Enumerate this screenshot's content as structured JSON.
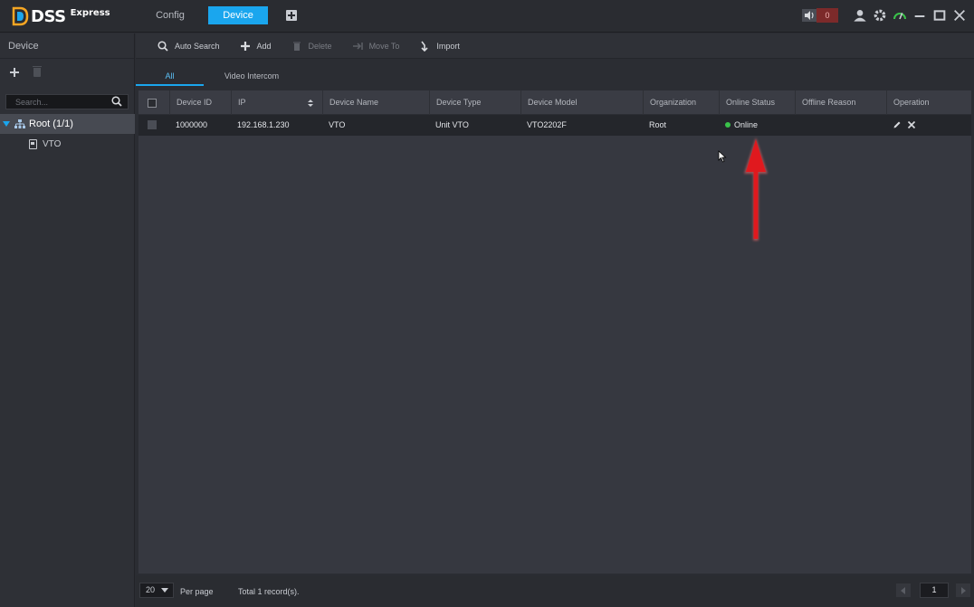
{
  "app": {
    "logo_main": "DSS",
    "logo_sub": "Express",
    "tabs": [
      {
        "label": "Config",
        "active": false
      },
      {
        "label": "Device",
        "active": true
      }
    ],
    "alarm_count": "0",
    "brand_color": "#1aa6ee"
  },
  "sidebar": {
    "title": "Device",
    "search_placeholder": "Search...",
    "tree": {
      "root_label": "Root (1/1)",
      "children": [
        {
          "label": "VTO"
        }
      ]
    }
  },
  "toolbar": {
    "auto_search": "Auto Search",
    "add": "Add",
    "delete": "Delete",
    "move_to": "Move To",
    "import": "Import"
  },
  "subtabs": [
    {
      "label": "All",
      "active": true
    },
    {
      "label": "Video Intercom",
      "active": false
    }
  ],
  "table": {
    "columns": [
      "Device ID",
      "IP",
      "Device Name",
      "Device Type",
      "Device Model",
      "Organization",
      "Online Status",
      "Offline Reason",
      "Operation"
    ],
    "rows": [
      {
        "device_id": "1000000",
        "ip": "192.168.1.230",
        "device_name": "VTO",
        "device_type": "Unit VTO",
        "device_model": "VTO2202F",
        "organization": "Root",
        "online_status": "Online",
        "offline_reason": ""
      }
    ],
    "status_color": "#3ac24a"
  },
  "footer": {
    "per_page_value": "20",
    "per_page_label": "Per page",
    "total_label": "Total 1 record(s).",
    "current_page": "1"
  },
  "annotation": {
    "arrow_color": "#e0191e"
  }
}
